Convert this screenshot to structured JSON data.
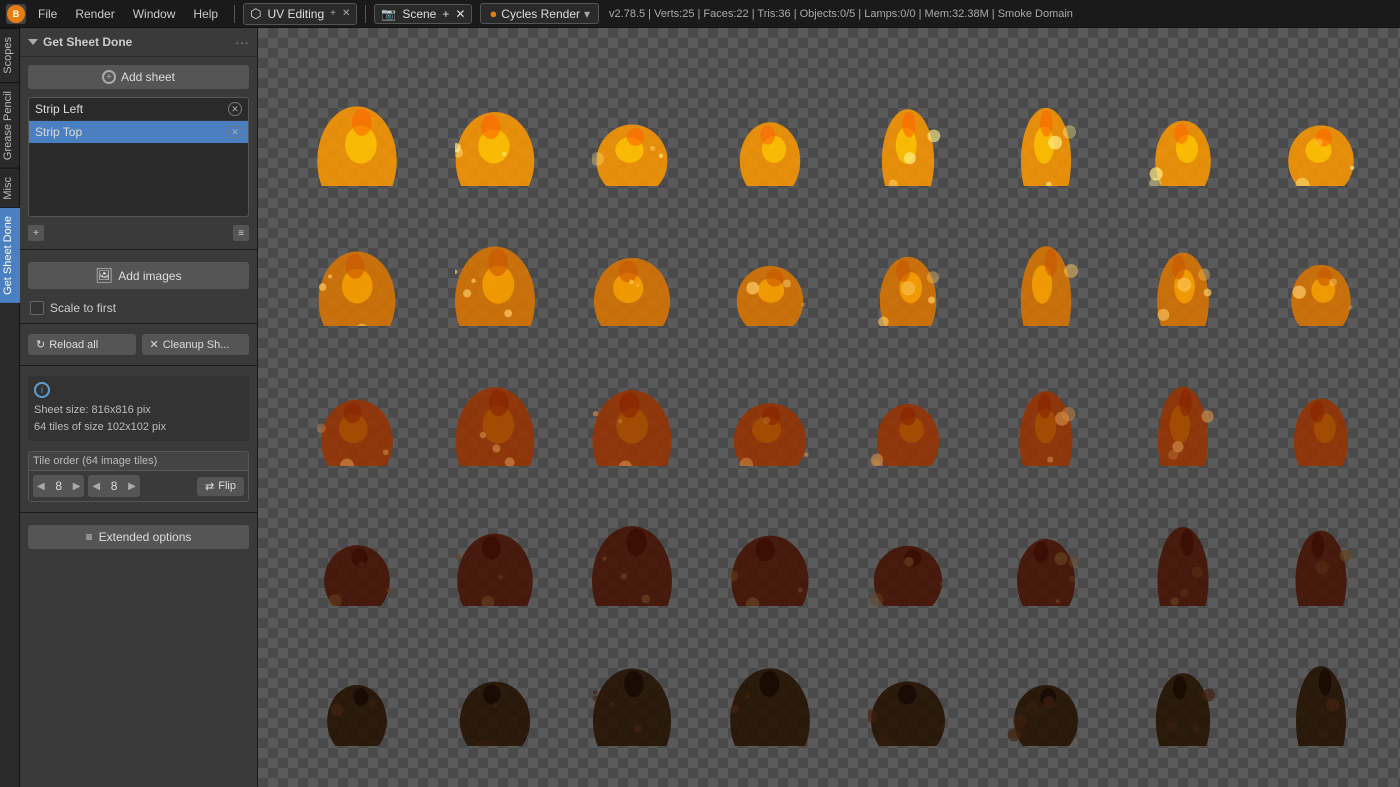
{
  "topbar": {
    "menus": [
      "File",
      "Render",
      "Window",
      "Help"
    ],
    "workspace_icon": "⬡",
    "workspace_label": "UV Editing",
    "scene_icon": "📷",
    "scene_label": "Scene",
    "engine_label": "Cycles Render",
    "blender_logo": "B",
    "version_info": "v2.78.5 | Verts:25 | Faces:22 | Tris:36 | Objects:0/5 | Lamps:0/0 | Mem:32.38M | Smoke Domain"
  },
  "side_tabs": [
    "Scopes",
    "Grease Pencil",
    "Misc",
    "Get Sheet Done"
  ],
  "panel": {
    "title": "Get Sheet Done",
    "add_sheet_label": "Add sheet",
    "sheets": [
      {
        "label": "Strip Left",
        "selected": false
      },
      {
        "label": "Strip Top",
        "selected": true
      }
    ],
    "add_images_label": "Add images",
    "scale_to_first_label": "Scale to first",
    "reload_all_label": "Reload all",
    "cleanup_label": "Cleanup Sh...",
    "info_icon": "i",
    "sheet_size_label": "Sheet size: 816x816 pix",
    "tiles_label": "64 tiles of size 102x102 pix",
    "tile_order_label": "Tile order (64 image tiles)",
    "tile_cols": "8",
    "tile_rows": "8",
    "flip_label": "Flip",
    "extended_options_label": "Extended options"
  },
  "canvas": {
    "rows": 5,
    "cols": 8
  },
  "colors": {
    "selected_blue": "#4a7fc1",
    "info_blue": "#5a9fd4",
    "panel_bg": "#3a3a3a",
    "canvas_bg": "#5a5a5a"
  }
}
